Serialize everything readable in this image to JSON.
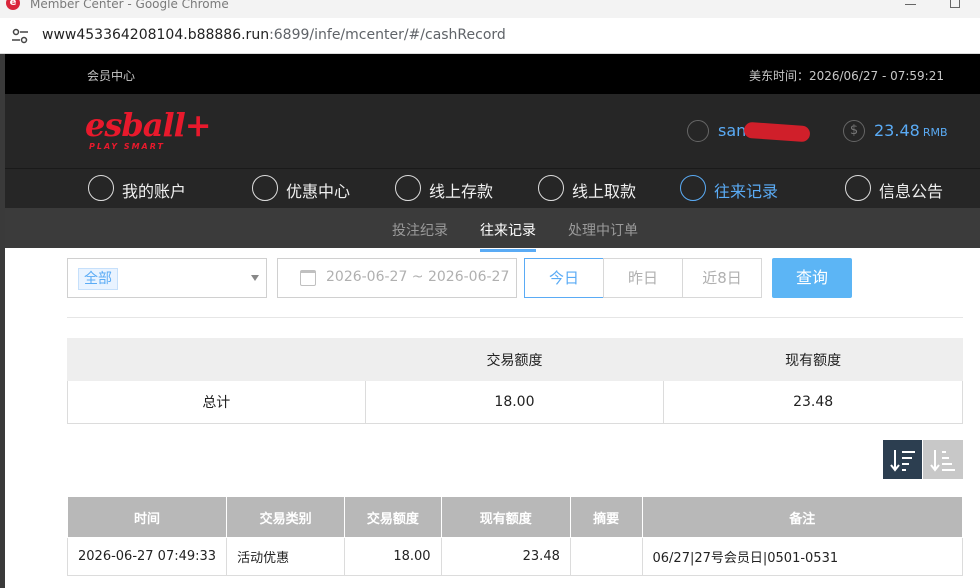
{
  "window": {
    "title": "Member Center - Google Chrome",
    "app_icon": "e"
  },
  "address_bar": {
    "url_main": "www453364208104.b88886.run",
    "url_rest": ":6899/infe/mcenter/#/cashRecord"
  },
  "topbar": {
    "member_center": "会员中心",
    "time": "美东时间：2026/06/27 - 07:59:21"
  },
  "header": {
    "logo_main": "esball+",
    "logo_sub": "PLAY SMART",
    "username": "san",
    "balance": "23.48",
    "balance_unit": "RMB",
    "money_symbol": "$"
  },
  "nav": {
    "items": [
      {
        "label": "我的账户"
      },
      {
        "label": "优惠中心"
      },
      {
        "label": "线上存款"
      },
      {
        "label": "线上取款"
      },
      {
        "label": "往来记录"
      },
      {
        "label": "信息公告"
      }
    ]
  },
  "subnav": {
    "items": [
      {
        "label": "投注纪录"
      },
      {
        "label": "往来记录"
      },
      {
        "label": "处理中订单"
      }
    ]
  },
  "filters": {
    "type_value": "全部",
    "date_range": "2026-06-27 ~ 2026-06-27",
    "today": "今日",
    "yesterday": "昨日",
    "last8": "近8日",
    "query": "查询"
  },
  "summary": {
    "col_amount": "交易额度",
    "col_balance": "现有额度",
    "row_label": "总计",
    "amount": "18.00",
    "balance": "23.48"
  },
  "records": {
    "headers": [
      "时间",
      "交易类别",
      "交易额度",
      "现有额度",
      "摘要",
      "备注"
    ],
    "rows": [
      {
        "time": "2026-06-27 07:49:33",
        "type": "活动优惠",
        "amount": "18.00",
        "balance": "23.48",
        "summary": "",
        "note": "06/27|27号会员日|0501-0531"
      }
    ]
  },
  "colors": {
    "accent": "#5aabf5",
    "brand_red": "#e8192c",
    "header_bg": "#262626"
  }
}
